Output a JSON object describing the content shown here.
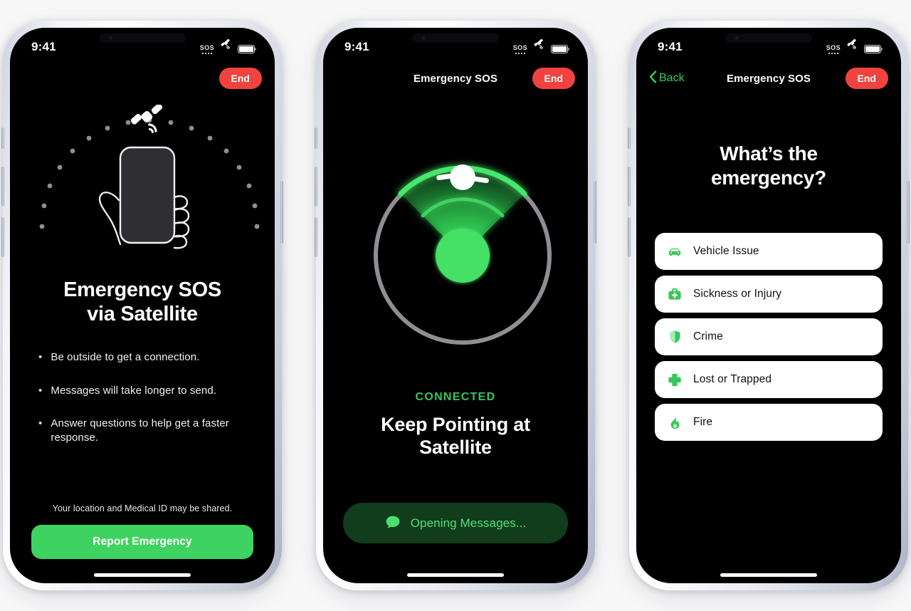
{
  "colors": {
    "accent_green": "#3ED360",
    "bright_green": "#4FE075",
    "connected_green": "#30C85A",
    "end_red": "#F0433F",
    "back_green": "#30D158",
    "screen_black": "#000000",
    "card_white": "#FFFFFF",
    "page_background": "#F7F7F8"
  },
  "status_bar": {
    "time": "9:41",
    "sos_label": "SOS",
    "sos_dots": 4,
    "satellite_icon": "satellite-icon",
    "battery_icon": "battery-full-icon"
  },
  "phones": [
    {
      "id": "phone-intro",
      "nav": {
        "title": "",
        "end_label": "End",
        "has_back": false
      },
      "illustration": "hand-holding-phone-with-satellite-arc",
      "title_line1": "Emergency SOS",
      "title_line2": "via Satellite",
      "bullets": [
        "Be outside to get a connection.",
        "Messages will take longer to send.",
        "Answer questions to help get a faster response."
      ],
      "bullet_marker": "•",
      "disclaimer": "Your location and Medical ID may be shared.",
      "cta_label": "Report Emergency"
    },
    {
      "id": "phone-connecting",
      "nav": {
        "title": "Emergency SOS",
        "end_label": "End",
        "has_back": false
      },
      "illustration": "satellite-radar-dial",
      "status_label": "CONNECTED",
      "heading_line1": "Keep Pointing at",
      "heading_line2": "Satellite",
      "action_pill": {
        "icon": "message-bubble-icon",
        "label": "Opening Messages..."
      }
    },
    {
      "id": "phone-questions",
      "nav": {
        "title": "Emergency SOS",
        "back_label": "Back",
        "end_label": "End",
        "has_back": true
      },
      "heading_line1": "What’s the",
      "heading_line2": "emergency?",
      "options": [
        {
          "label": "Vehicle Issue",
          "icon": "car-icon"
        },
        {
          "label": "Sickness or Injury",
          "icon": "medical-kit-icon"
        },
        {
          "label": "Crime",
          "icon": "shield-icon"
        },
        {
          "label": "Lost or Trapped",
          "icon": "cross-icon"
        },
        {
          "label": "Fire",
          "icon": "flame-icon"
        }
      ]
    }
  ]
}
